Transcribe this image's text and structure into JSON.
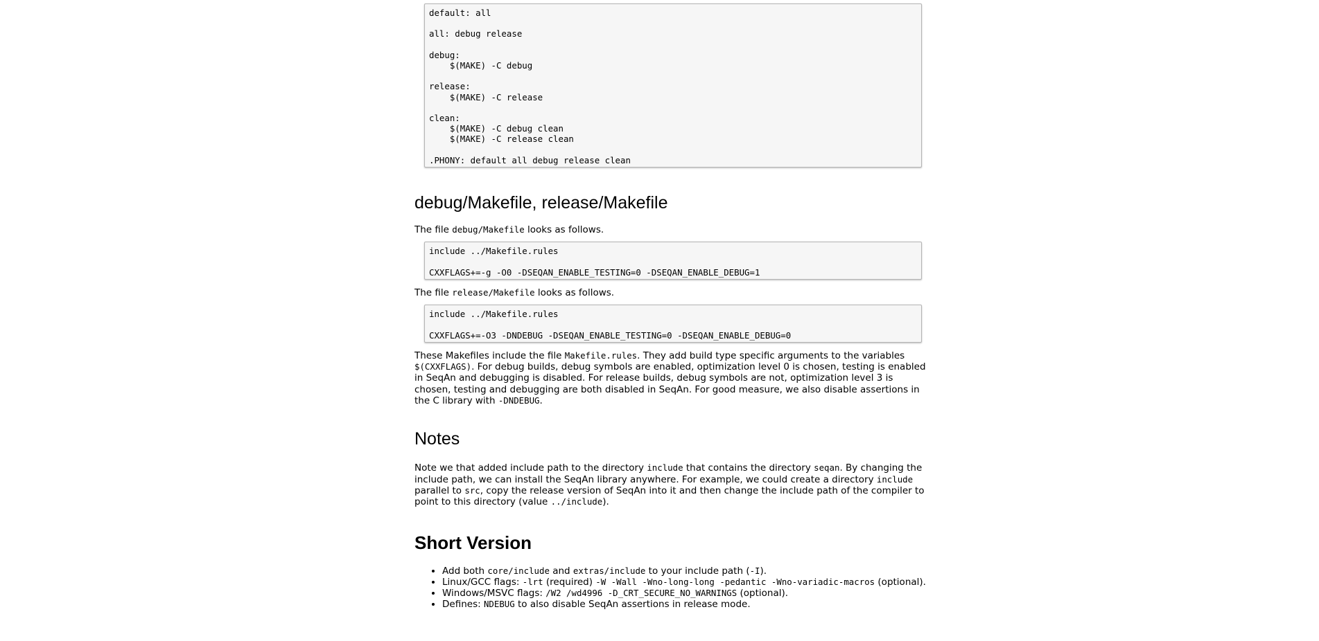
{
  "code_top": "default: all\n\nall: debug release\n\ndebug:\n    $(MAKE) -C debug\n\nrelease:\n    $(MAKE) -C release\n\nclean:\n    $(MAKE) -C debug clean\n    $(MAKE) -C release clean\n\n.PHONY: default all debug release clean",
  "heading_makefiles": "debug/Makefile, release/Makefile",
  "debug_intro": {
    "pre": "The file ",
    "code": "debug/Makefile",
    "post": " looks as follows."
  },
  "code_debug": "include ../Makefile.rules\n\nCXXFLAGS+=-g -O0 -DSEQAN_ENABLE_TESTING=0 -DSEQAN_ENABLE_DEBUG=1",
  "release_intro": {
    "pre": "The file ",
    "code": "release/Makefile",
    "post": " looks as follows."
  },
  "code_release": "include ../Makefile.rules\n\nCXXFLAGS+=-O3 -DNDEBUG -DSEQAN_ENABLE_TESTING=0 -DSEQAN_ENABLE_DEBUG=0",
  "makefiles_para": {
    "t1": "These Makefiles include the file ",
    "c1": "Makefile.rules",
    "t2": ". They add build type specific arguments to the variables ",
    "c2": "$(CXXFLAGS)",
    "t3": ". For debug builds, debug symbols are enabled, optimization level 0 is chosen, testing is enabled in SeqAn and debugging is disabled. For release builds, debug symbols are not, optimization level 3 is chosen, testing and debugging are both disabled in SeqAn. For good measure, we also disable assertions in the C library with ",
    "c3": "-DNDEBUG",
    "t4": "."
  },
  "heading_notes": "Notes",
  "notes_para": {
    "t1": "Note we that added include path to the directory ",
    "c1": "include",
    "t2": " that contains the directory ",
    "c2": "seqan",
    "t3": ". By changing the include path, we can install the SeqAn library anywhere. For example, we could create a directory ",
    "c3": "include",
    "t4": " parallel to ",
    "c4": "src",
    "t5": ", copy the release version of SeqAn into it and then change the include path of the compiler to point to this directory (value ",
    "c5": "../include",
    "t6": ")."
  },
  "heading_short": "Short Version",
  "short_list": {
    "item1": {
      "t1": "Add both ",
      "c1": "core/include",
      "t2": " and ",
      "c2": "extras/include",
      "t3": " to your include path (",
      "c3": "-I",
      "t4": ")."
    },
    "item2": {
      "t1": "Linux/GCC flags: ",
      "c1": "-lrt",
      "t2": " (required) ",
      "c2": "-W -Wall -Wno-long-long -pedantic -Wno-variadic-macros",
      "t3": " (optional)."
    },
    "item3": {
      "t1": "Windows/MSVC flags: ",
      "c1": "/W2 /wd4996 -D_CRT_SECURE_NO_WARNINGS",
      "t2": " (optional)."
    },
    "item4": {
      "t1": "Defines: ",
      "c1": "NDEBUG",
      "t2": " to also disable SeqAn assertions in release mode."
    }
  }
}
